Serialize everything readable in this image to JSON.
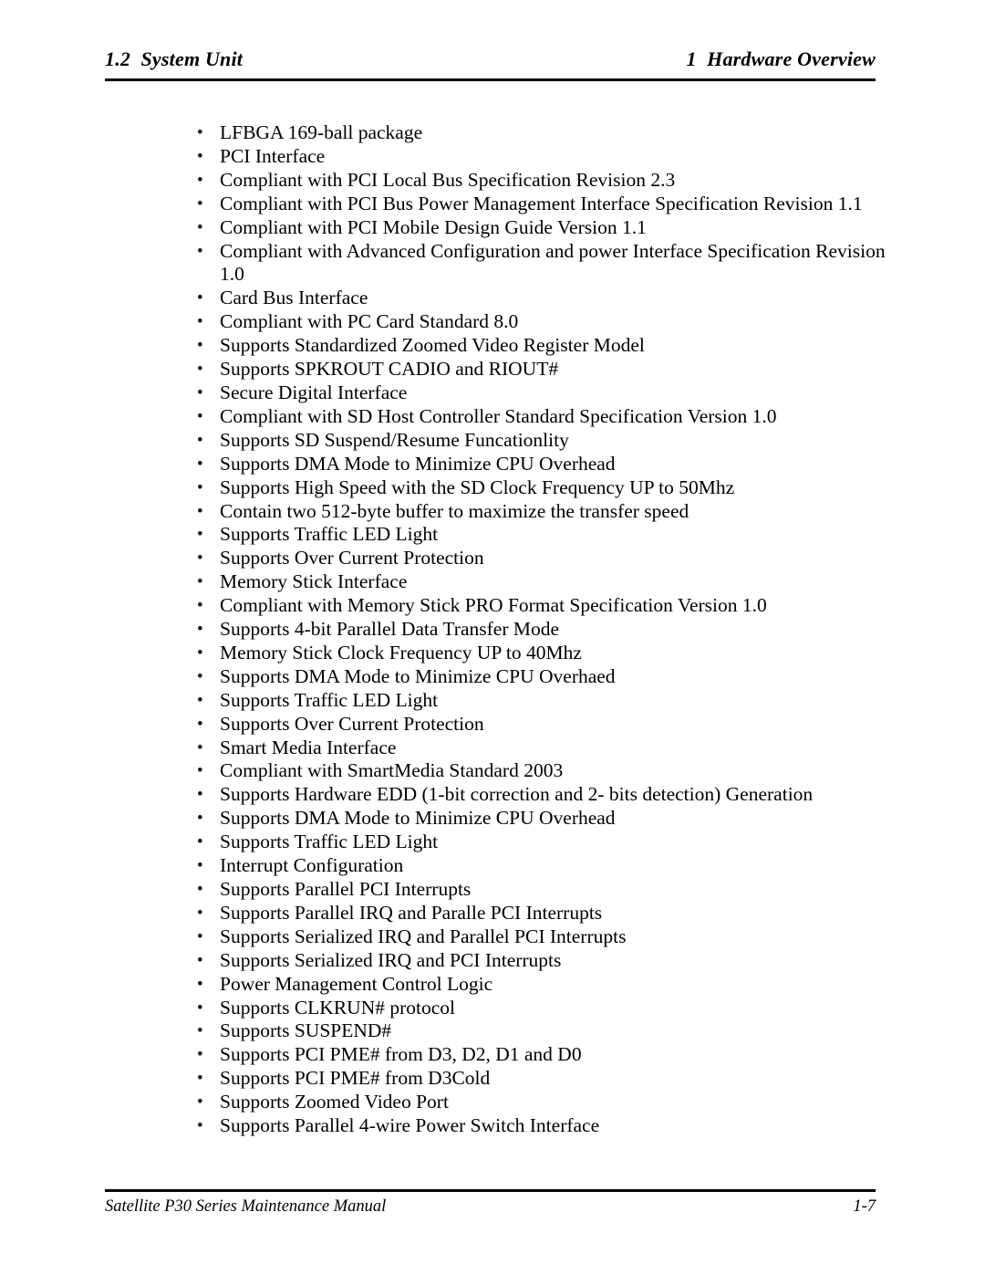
{
  "header": {
    "left": "1.2  System Unit",
    "right": "1  Hardware Overview"
  },
  "footer": {
    "left": "Satellite P30 Series Maintenance Manual",
    "right": "1-7"
  },
  "content": {
    "bullets": [
      "LFBGA 169-ball package",
      "PCI Interface",
      "Compliant with PCI Local Bus Specification Revision 2.3",
      "Compliant with PCI Bus Power Management Interface Specification Revision 1.1",
      "Compliant with PCI Mobile Design Guide Version 1.1",
      "Compliant with Advanced Configuration and power Interface Specification Revision 1.0",
      "Card Bus Interface",
      "Compliant with PC Card Standard 8.0",
      "Supports Standardized Zoomed Video Register Model",
      "Supports SPKROUT CADIO and RIOUT#",
      "Secure Digital Interface",
      "Compliant with SD Host Controller Standard Specification Version 1.0",
      "Supports SD Suspend/Resume Funcationlity",
      "Supports DMA Mode to Minimize CPU Overhead",
      "Supports High Speed with the SD Clock Frequency UP to 50Mhz",
      "Contain two 512-byte buffer to maximize the transfer speed",
      "Supports Traffic LED Light",
      "Supports Over Current Protection",
      "Memory Stick Interface",
      "Compliant with Memory Stick PRO Format Specification Version 1.0",
      "Supports 4-bit Parallel Data Transfer Mode",
      "Memory Stick Clock Frequency UP to 40Mhz",
      "Supports DMA Mode to Minimize CPU Overhaed",
      "Supports Traffic LED Light",
      "Supports Over Current Protection",
      "Smart Media Interface",
      "Compliant with SmartMedia Standard 2003",
      "Supports Hardware EDD (1-bit correction and 2- bits detection) Generation",
      "Supports DMA Mode to Minimize CPU Overhead",
      "Supports Traffic LED Light",
      "Interrupt Configuration",
      "Supports Parallel PCI Interrupts",
      "Supports Parallel IRQ and Paralle PCI Interrupts",
      "Supports Serialized IRQ and Parallel PCI Interrupts",
      "Supports Serialized IRQ and PCI Interrupts",
      "Power Management Control Logic",
      "Supports CLKRUN# protocol",
      "Supports SUSPEND#",
      "Supports PCI PME# from D3, D2, D1 and D0",
      "Supports PCI PME# from D3Cold",
      "Supports Zoomed Video Port",
      "Supports Parallel 4-wire Power Switch Interface"
    ]
  }
}
